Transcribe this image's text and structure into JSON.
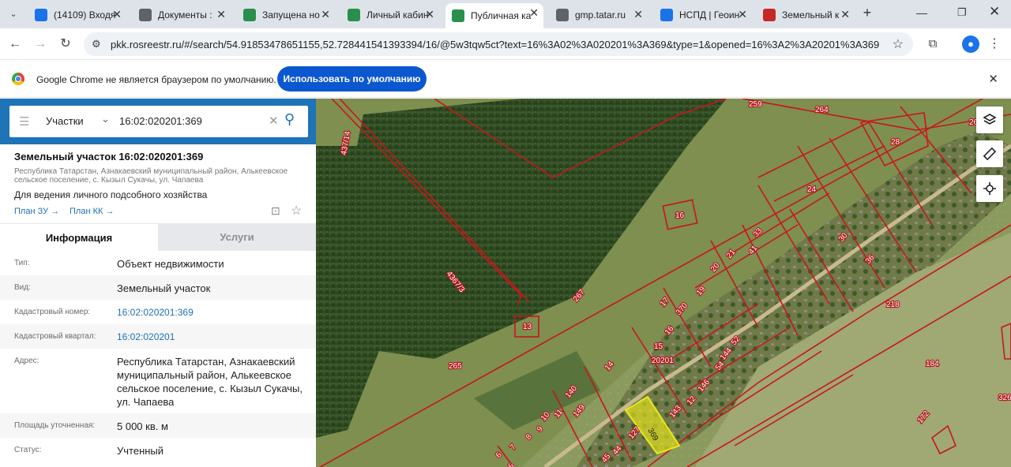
{
  "browser": {
    "tabs": [
      {
        "title": "(14109) Входя",
        "icon": "mail-icon",
        "color": "#1a73e8"
      },
      {
        "title": "Документы : ",
        "icon": "document-icon",
        "color": "#5f6368"
      },
      {
        "title": "Запущена но",
        "icon": "rosreestr-icon",
        "color": "#2a8f4c"
      },
      {
        "title": "Личный кабин",
        "icon": "rosreestr-icon",
        "color": "#2a8f4c"
      },
      {
        "title": "Публичная ка",
        "icon": "rosreestr-icon",
        "color": "#2a8f4c"
      },
      {
        "title": "gmp.tatar.ru",
        "icon": "globe-icon",
        "color": "#5f6368"
      },
      {
        "title": "НСПД | Геоин",
        "icon": "nspd-icon",
        "color": "#1a73e8"
      },
      {
        "title": "Земельный к",
        "icon": "flag-icon",
        "color": "#c62828"
      }
    ],
    "address": "pkk.rosreestr.ru/#/search/54.91853478651155,52.728441541393394/16/@5w3tqw5ct?text=16%3A02%3A020201%3A369&type=1&opened=16%3A2%3A20201%3A369",
    "infobar_message": "Google Chrome не является браузером по умолчанию.",
    "infobar_button": "Использовать по умолчанию"
  },
  "panel": {
    "search_type": "Участки",
    "search_query": "16:02:020201:369",
    "object_title": "Земельный участок 16:02:020201:369",
    "object_address": "Республика Татарстан, Азнакаевский муниципальный район, Алькеевское сельское поселение, с. Кызыл Сукачы, ул. Чапаева",
    "object_use": "Для ведения личного подсобного хозяйства",
    "link_plan_zu": "План ЗУ →",
    "link_plan_kk": "План КК →",
    "tab_info": "Информация",
    "tab_services": "Услуги",
    "rows": [
      {
        "label": "Тип:",
        "value": "Объект недвижимости"
      },
      {
        "label": "Вид:",
        "value": "Земельный участок"
      },
      {
        "label": "Кадастровый номер:",
        "value": "16:02:020201:369"
      },
      {
        "label": "Кадастровый квартал:",
        "value": "16:02:020201"
      },
      {
        "label": "Адрес:",
        "value": "Республика Татарстан, Азнакаевский муниципальный район, Алькеевское сельское поселение, с. Кызыл Сукачы, ул. Чапаева"
      },
      {
        "label": "Площадь уточненная:",
        "value": "5 000 кв. м"
      },
      {
        "label": "Статус:",
        "value": "Учтенный"
      }
    ]
  },
  "map": {
    "labels": [
      "259",
      "264",
      "261",
      "28",
      "437/14",
      "16",
      "24",
      "4367/3",
      "267",
      "13",
      "265",
      "20201",
      "184",
      "218",
      "326",
      "172",
      "15",
      "369",
      "127",
      "140",
      "14",
      "16",
      "17",
      "370",
      "19",
      "20",
      "21",
      "33",
      "30",
      "36",
      "41",
      "52",
      "54",
      "144",
      "146",
      "149",
      "143",
      "12",
      "11",
      "10",
      "9",
      "8",
      "7",
      "6",
      "5",
      "44",
      "45"
    ],
    "highlight_color": "#e8e81a",
    "boundary_color": "#c8161e"
  },
  "colors": {
    "accent": "#1f73b7",
    "chrome_button": "#0b57d0"
  }
}
